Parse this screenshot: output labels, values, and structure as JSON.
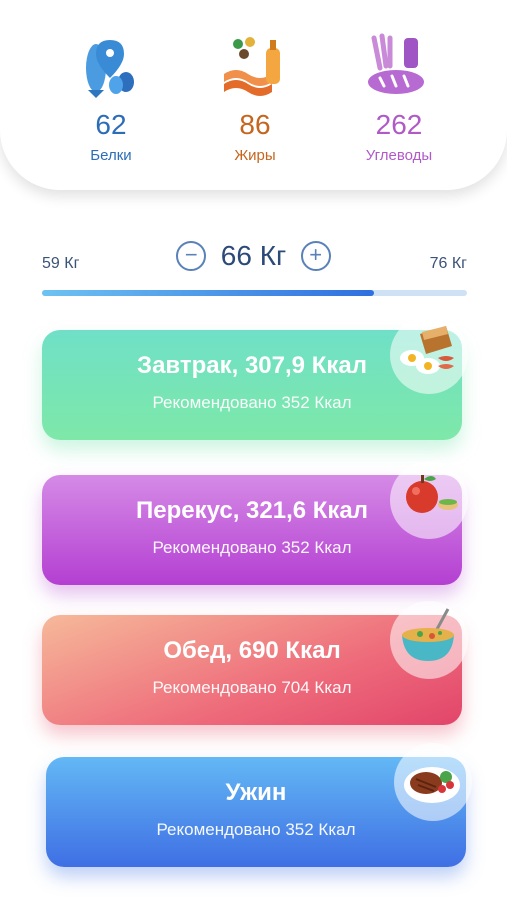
{
  "macros": [
    {
      "value": "62",
      "label": "Белки"
    },
    {
      "value": "86",
      "label": "Жиры"
    },
    {
      "value": "262",
      "label": "Углеводы"
    }
  ],
  "weight": {
    "min": "59 Кг",
    "max": "76 Кг",
    "current": "66 Кг",
    "minus_symbol": "−",
    "plus_symbol": "+",
    "progress_fraction": 0.78
  },
  "meals": [
    {
      "title": "Завтрак, 307,9 Ккал",
      "subtitle": "Рекомендовано 352 Ккал"
    },
    {
      "title": "Перекус, 321,6 Ккал",
      "subtitle": "Рекомендовано 352 Ккал"
    },
    {
      "title": "Обед, 690 Ккал",
      "subtitle": "Рекомендовано 704 Ккал"
    },
    {
      "title": "Ужин",
      "subtitle": "Рекомендовано 352 Ккал"
    }
  ],
  "icons": {
    "protein": "fish-meat-egg-icon",
    "fat": "bacon-oil-olives-icon",
    "carb": "bread-wheat-icon",
    "breakfast": "eggs-toast-bacon-icon",
    "snack": "apple-sandwich-icon",
    "lunch": "soup-bowl-icon",
    "dinner": "steak-plate-icon"
  },
  "colors": {
    "protein": "#2c6db7",
    "fat": "#c5651e",
    "carb": "#b05ac8"
  }
}
